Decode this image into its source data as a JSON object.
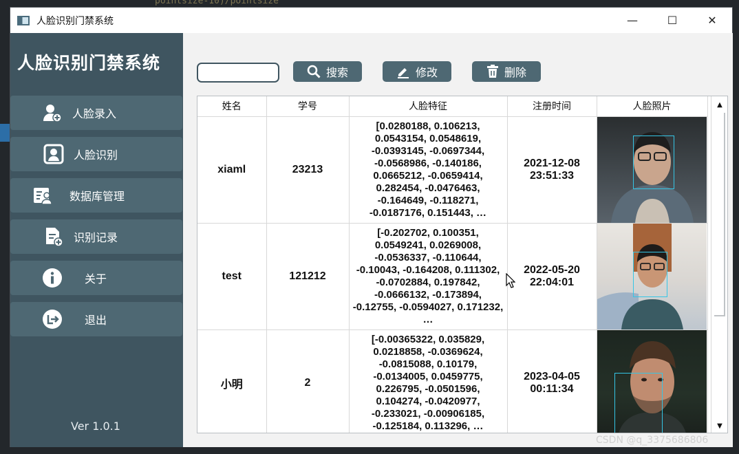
{
  "background": {
    "code_snippet": "pointsize-10)/pointsize"
  },
  "window": {
    "title": "人脸识别门禁系统",
    "controls": {
      "minimize": "—",
      "maximize": "☐",
      "close": "✕"
    }
  },
  "sidebar": {
    "title": "人脸识别门禁系统",
    "items": [
      {
        "label": "人脸录入",
        "icon": "user-add-icon"
      },
      {
        "label": "人脸识别",
        "icon": "face-scan-icon"
      },
      {
        "label": "数据库管理",
        "icon": "database-user-icon"
      },
      {
        "label": "识别记录",
        "icon": "document-add-icon"
      },
      {
        "label": "关于",
        "icon": "info-icon"
      },
      {
        "label": "退出",
        "icon": "logout-icon"
      }
    ],
    "version": "Ver 1.0.1"
  },
  "toolbar": {
    "search_value": "",
    "search_label": "搜索",
    "edit_label": "修改",
    "delete_label": "删除"
  },
  "table": {
    "headers": [
      "姓名",
      "学号",
      "人脸特征",
      "注册时间",
      "人脸照片"
    ],
    "rows": [
      {
        "name": "xiaml",
        "id": "23213",
        "feature": "[0.0280188, 0.106213, 0.0543154, 0.0548619, -0.0393145, -0.0697344, -0.0568986, -0.140186, 0.0665212, -0.0659414, 0.282454, -0.0476463, -0.164649, -0.118271, -0.0187176, 0.151443, …",
        "date": "2021-12-08",
        "time": "23:51:33"
      },
      {
        "name": "test",
        "id": "121212",
        "feature": "[-0.202702, 0.100351, 0.0549241, 0.0269008, -0.0536337, -0.110644, -0.10043, -0.164208, 0.111302, -0.0702884, 0.197842, -0.0666132, -0.173894, -0.12755, -0.0594027, 0.171232, …",
        "date": "2022-05-20",
        "time": "22:04:01"
      },
      {
        "name": "小明",
        "id": "2",
        "feature": "[-0.00365322, 0.035829, 0.0218858, -0.0369624, -0.0815088, 0.10179, -0.0134005, 0.0459775, 0.226795, -0.0501596, 0.104274, -0.0420977, -0.233021, -0.00906185, -0.125184, 0.113296, …",
        "date": "2023-04-05",
        "time": "00:11:34"
      }
    ]
  },
  "watermark": "CSDN @q_3375686806",
  "colors": {
    "sidebar": "#3f5560",
    "nav_item": "#4e6873",
    "face_frame": "#35c6e6"
  }
}
